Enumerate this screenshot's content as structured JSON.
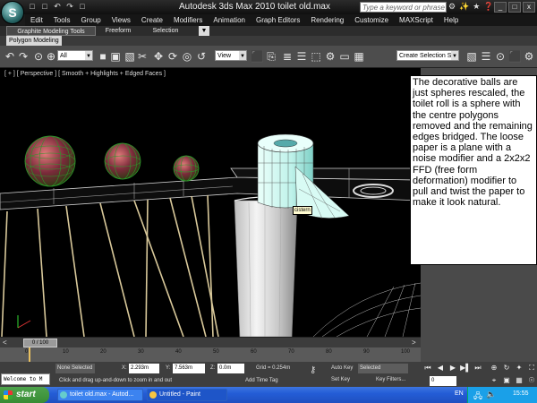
{
  "titlebar": {
    "app_title": "Autodesk 3ds Max  2010      toilet old.max",
    "search_placeholder": "Type a keyword or phrase",
    "logo_glyph": "S",
    "quick_access": [
      "□",
      "□",
      "↶",
      "↷",
      "□"
    ],
    "right_icons": "⚙✨★❓",
    "window_buttons": [
      "_",
      "□",
      "x"
    ]
  },
  "menubar": {
    "items": [
      "Edit",
      "Tools",
      "Group",
      "Views",
      "Create",
      "Modifiers",
      "Animation",
      "Graph Editors",
      "Rendering",
      "Customize",
      "MAXScript",
      "Help"
    ]
  },
  "ribbon": {
    "tabs": [
      "Graphite Modeling Tools",
      "Freeform",
      "Selection"
    ],
    "collapse_glyph": "▼",
    "subtab": "Polygon Modeling"
  },
  "toolbar": {
    "filter_value": "All",
    "refcoord_value": "View",
    "named_selection": "Create Selection Se",
    "icons": [
      "↶",
      "↷",
      "⊙",
      "⊕",
      "↺",
      "■",
      "▣",
      "✥",
      "⟳",
      "▧",
      "✂",
      "◎",
      "⬛",
      "⎘",
      "≣",
      "☰",
      "⬚",
      "⚙",
      "▭",
      "▦"
    ]
  },
  "viewport": {
    "label": "[ + ] [ Perspective ] [ Smooth + Highlights + Edged Faces ]",
    "tooltip": "cistern"
  },
  "note": {
    "text": "The decorative balls are just spheres rescaled, the toilet roll is a sphere with the centre polygons removed and the remaining edges bridged. The loose paper is a plane with a noise modifier and a 2x2x2 FFD (free form deformation) modifier to pull and twist the paper to make it look natural."
  },
  "timeline": {
    "frame_display": "0 / 100",
    "prev_arrow": "<",
    "next_arrow": ">",
    "ticks": [
      "0",
      "10",
      "20",
      "30",
      "40",
      "50",
      "60",
      "70",
      "80",
      "90",
      "100"
    ]
  },
  "status": {
    "welcome": "Welcome to M",
    "selection": "None Selected",
    "x_label": "X:",
    "x_value": "2.293m",
    "y_label": "Y:",
    "y_value": "7.563m",
    "z_label": "Z:",
    "z_value": "0.0m",
    "grid": "Grid = 0.254m",
    "auto_key": "Auto Key",
    "key_mode": "Selected",
    "set_key": "Set Key",
    "key_filters": "Key Filters...",
    "prompt": "Click and drag up-and-down to zoom in and out",
    "add_time_tag": "Add Time Tag",
    "frame_field": "0",
    "playback": [
      "⏮",
      "◀",
      "▶",
      "▶▌",
      "⏭"
    ],
    "nav_icons": [
      "⊕",
      "↻",
      "✦",
      "⛶",
      "⌖",
      "▣",
      "▦",
      "☉"
    ]
  },
  "taskbar": {
    "start_label": "start",
    "tasks": [
      "toilet old.max - Autod...",
      "Untitled - Paint"
    ],
    "language": "EN",
    "clock": "15:55"
  },
  "colors": {
    "wire_green": "#2a9a2a",
    "roll_cyan": "#c9f7ef",
    "rail_tan": "#d8c89a"
  }
}
